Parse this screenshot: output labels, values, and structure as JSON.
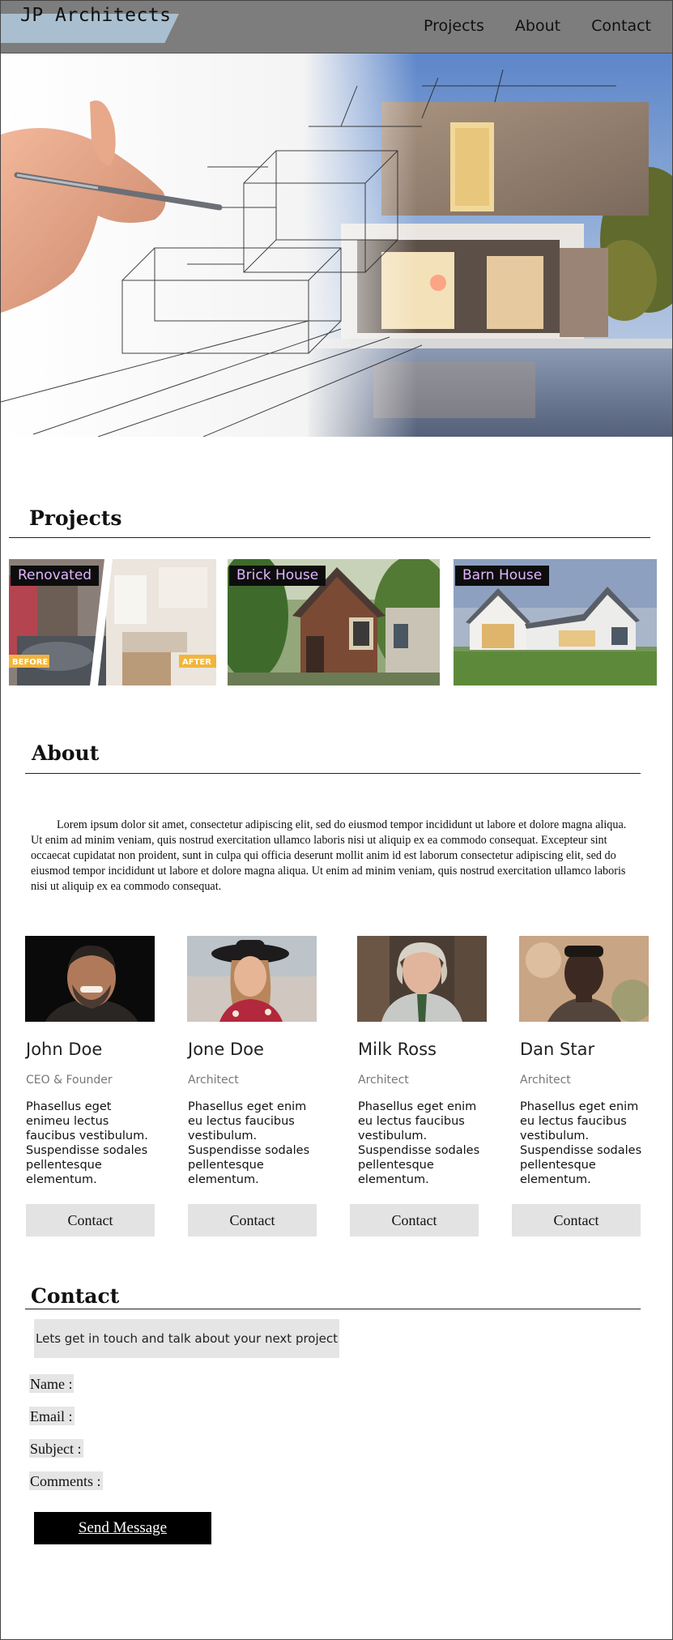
{
  "header": {
    "brand": "JP Architects",
    "nav": [
      "Projects",
      "About",
      "Contact"
    ]
  },
  "projects": {
    "title": "Projects",
    "items": [
      {
        "label": "Renovated",
        "before": "BEFORE",
        "after": "AFTER"
      },
      {
        "label": "Brick House"
      },
      {
        "label": "Barn House"
      }
    ]
  },
  "about": {
    "title": "About",
    "text": "Lorem ipsum dolor sit amet, consectetur adipiscing elit, sed do eiusmod tempor incididunt ut labore et dolore magna aliqua. Ut enim ad minim veniam, quis nostrud exercitation ullamco laboris nisi ut aliquip ex ea commodo consequat. Excepteur sint occaecat cupidatat non proident, sunt in culpa qui officia deserunt mollit anim id est laborum consectetur adipiscing elit, sed do eiusmod tempor incididunt ut labore et dolore magna aliqua. Ut enim ad minim veniam, quis nostrud exercitation ullamco laboris nisi ut aliquip ex ea commodo consequat.",
    "team": [
      {
        "name": "John Doe",
        "role": "CEO & Founder",
        "desc": "Phasellus eget enimeu lectus faucibus vestibulum. Suspendisse sodales pellentesque elementum.",
        "button": "Contact"
      },
      {
        "name": "Jone Doe",
        "role": "Architect",
        "desc": "Phasellus eget enim eu lectus faucibus vestibulum. Suspendisse sodales pellentesque elementum.",
        "button": "Contact"
      },
      {
        "name": "Milk Ross",
        "role": "Architect",
        "desc": "Phasellus eget enim eu lectus faucibus vestibulum. Suspendisse sodales pellentesque elementum.",
        "button": "Contact"
      },
      {
        "name": "Dan Star",
        "role": "Architect",
        "desc": "Phasellus eget enim eu lectus faucibus vestibulum. Suspendisse sodales pellentesque elementum.",
        "button": "Contact"
      }
    ]
  },
  "contact": {
    "title": "Contact",
    "intro": "Lets get in touch and talk about your next project",
    "fields": [
      "Name :",
      "Email :",
      "Subject :",
      "Comments :"
    ],
    "send": "Send Message"
  },
  "colors": {
    "topbar": "#7d7d7d",
    "brand_bg": "#a9bfcf",
    "label_text": "#e0b6ff",
    "button_bg": "#e3e3e3",
    "send_bg": "#000000"
  }
}
